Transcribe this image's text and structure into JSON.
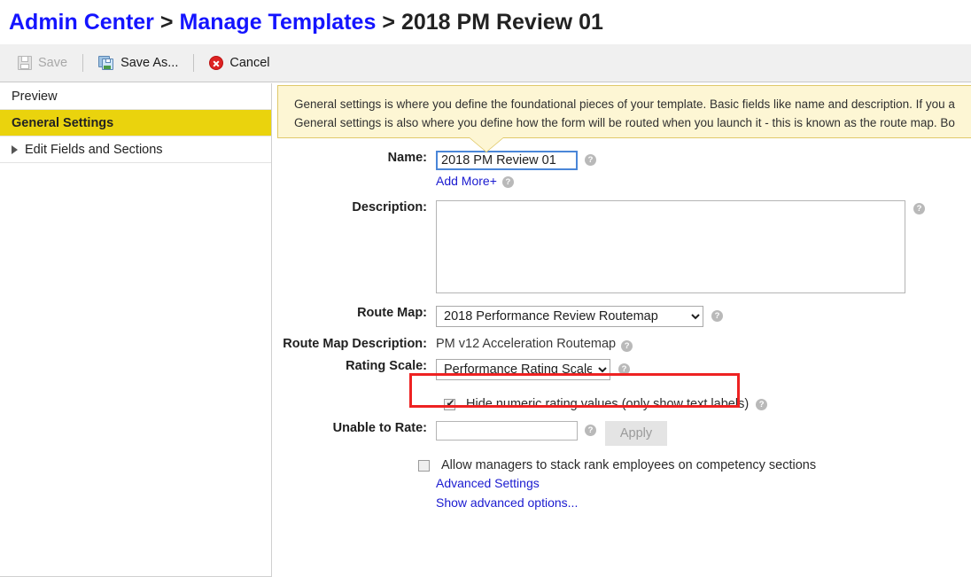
{
  "breadcrumb": {
    "root": "Admin Center",
    "separator": ">",
    "section": "Manage Templates",
    "current": "2018 PM Review 01"
  },
  "toolbar": {
    "save_label": "Save",
    "save_as_label": "Save As...",
    "cancel_label": "Cancel",
    "save_disabled": true
  },
  "sidebar": {
    "items": [
      {
        "label": "Preview",
        "active": false,
        "expandable": false
      },
      {
        "label": "General Settings",
        "active": true,
        "expandable": false
      },
      {
        "label": "Edit Fields and Sections",
        "active": false,
        "expandable": true
      }
    ]
  },
  "banner": {
    "line1": "General settings is where you define the foundational pieces of your template. Basic fields like name and description. If you a",
    "line2": "General settings is also where you define how the form will be routed when you launch it - this is known as the route map. Bo"
  },
  "form": {
    "name": {
      "label": "Name:",
      "value": "2018 PM Review 01",
      "add_more_label": "Add More+"
    },
    "description": {
      "label": "Description:",
      "value": "",
      "placeholder": ""
    },
    "route_map": {
      "label": "Route Map:",
      "selected": "2018 Performance Review Routemap",
      "options": [
        "2018 Performance Review Routemap"
      ]
    },
    "route_map_description": {
      "label": "Route Map Description:",
      "value": "PM v12 Acceleration Routemap"
    },
    "rating_scale": {
      "label": "Rating Scale:",
      "selected": "Performance Rating Scale",
      "options": [
        "Performance Rating Scale"
      ]
    },
    "hide_numeric": {
      "label": "Hide numeric rating values (only show text labels)",
      "checked": true,
      "highlighted": true
    },
    "unable_to_rate": {
      "label": "Unable to Rate:",
      "value": "",
      "apply_label": "Apply",
      "apply_disabled": true
    },
    "stack_rank": {
      "label": "Allow managers to stack rank employees on competency sections",
      "checked": false
    },
    "advanced_settings_link": "Advanced Settings",
    "show_advanced_link": "Show advanced options..."
  },
  "colors": {
    "link": "#1414ff",
    "nav_active": "#ead30d",
    "banner_bg": "#fdf6d4",
    "banner_border": "#e0c96a",
    "annotation": "#ee2222"
  }
}
